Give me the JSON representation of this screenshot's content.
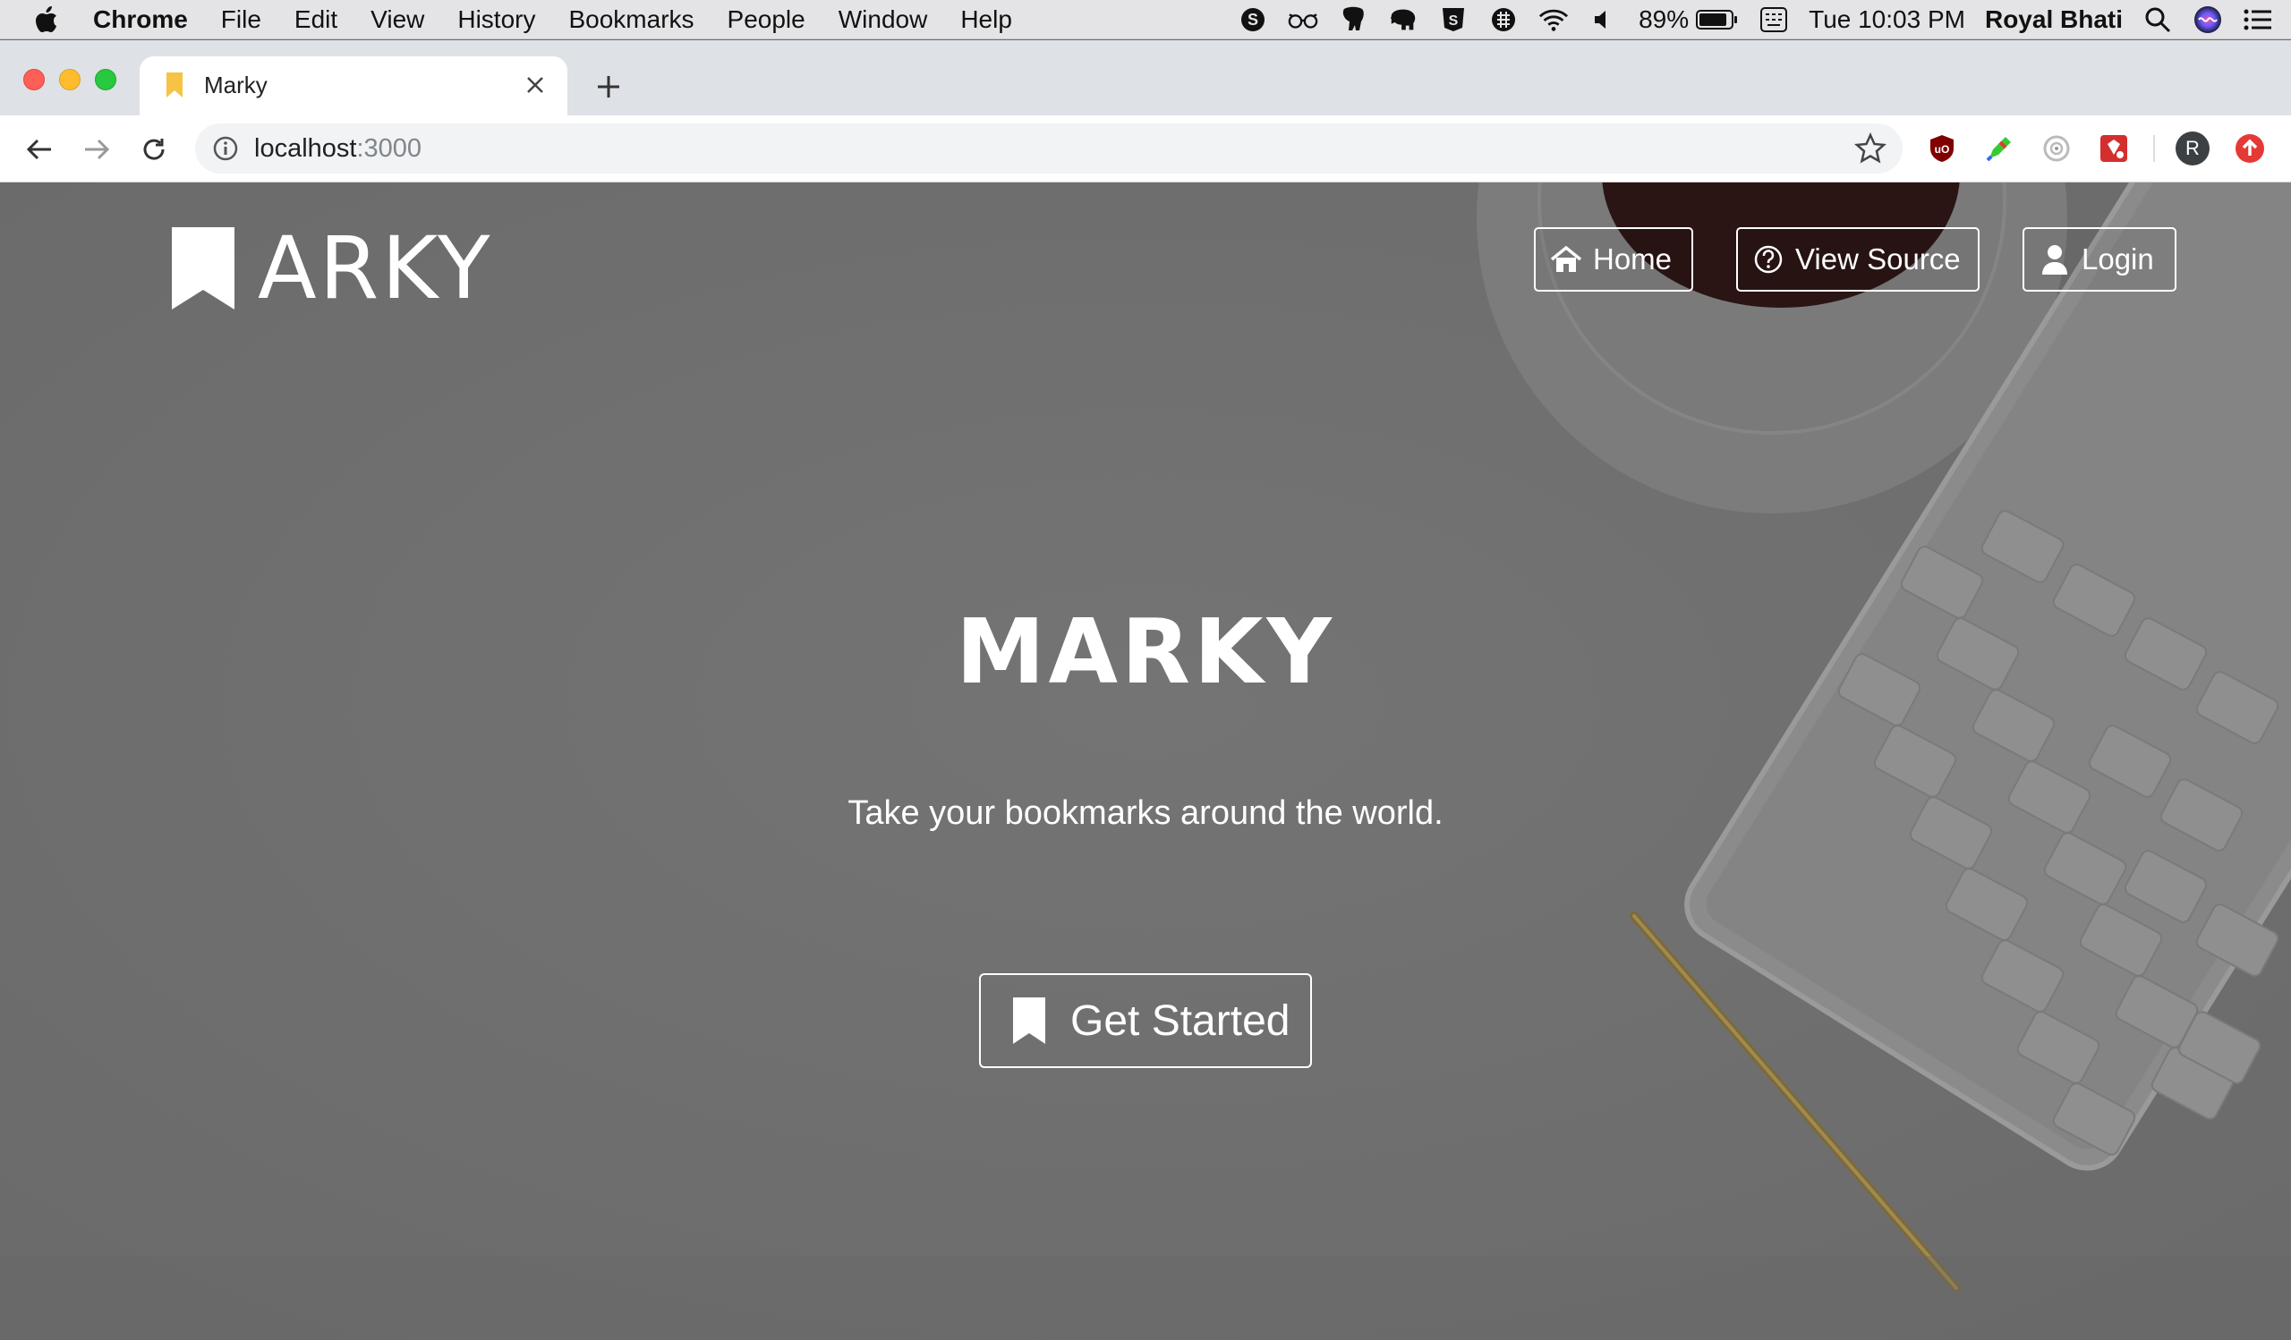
{
  "menubar": {
    "app_name": "Chrome",
    "items": [
      "File",
      "Edit",
      "View",
      "History",
      "Bookmarks",
      "People",
      "Window",
      "Help"
    ],
    "battery": "89%",
    "datetime": "Tue 10:03 PM",
    "user": "Royal Bhati",
    "status_icons": [
      "skype-icon",
      "glasses-icon",
      "postgres-elephant-icon",
      "evernote-elephant-icon",
      "s-icon",
      "menu-grid-icon",
      "wifi-icon",
      "volume-icon",
      "battery-icon",
      "keyboard-icon",
      "search-icon",
      "siri-icon",
      "list-icon"
    ]
  },
  "browser": {
    "tab_title": "Marky",
    "url_host": "localhost",
    "url_port": ":3000",
    "profile_initial": "R",
    "extensions": [
      "ublock-icon",
      "color-picker-icon",
      "eye-dropper-icon",
      "ruby-gem-icon"
    ]
  },
  "site": {
    "brand": "ARKY",
    "nav": {
      "home": "Home",
      "view_source": "View Source",
      "login": "Login"
    },
    "hero": {
      "title": "MARKY",
      "subtitle": "Take your bookmarks around the world.",
      "cta": "Get Started"
    }
  },
  "colors": {
    "overlay": "#707070",
    "text": "#ffffff",
    "tab_favicon": "#f6c344",
    "profile_avatar": "#3c4043",
    "update_badge": "#e53935"
  }
}
